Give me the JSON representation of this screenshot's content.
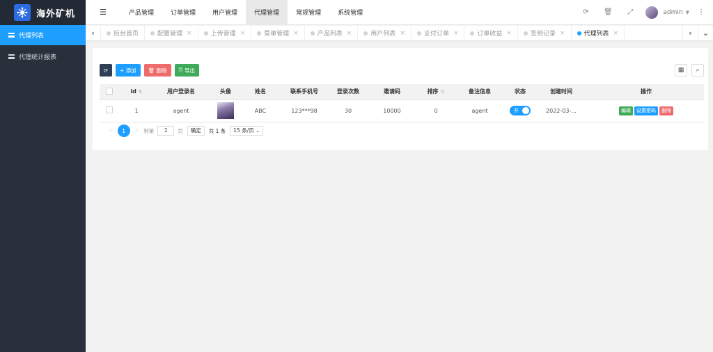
{
  "app": {
    "title": "海外矿机"
  },
  "sidebar": {
    "items": [
      {
        "label": "代理列表",
        "active": true
      },
      {
        "label": "代理统计报表",
        "active": false
      }
    ]
  },
  "topnav": {
    "items": [
      "产品管理",
      "订单管理",
      "用户管理",
      "代理管理",
      "常规管理",
      "系统管理"
    ],
    "active": "代理管理"
  },
  "user": {
    "name": "admin"
  },
  "tabs": {
    "items": [
      "后台首页",
      "配置管理",
      "上传管理",
      "菜单管理",
      "产品列表",
      "用户列表",
      "支付订单",
      "订单收益",
      "签到记录",
      "代理列表"
    ],
    "active": "代理列表"
  },
  "toolbar": {
    "add": "添加",
    "delete": "删除",
    "export": "导出"
  },
  "table": {
    "headers": [
      "id",
      "用户登录名",
      "头像",
      "姓名",
      "联系手机号",
      "登录次数",
      "邀请码",
      "排序",
      "备注信息",
      "状态",
      "创建时间",
      "操作"
    ],
    "rows": [
      {
        "id": "1",
        "login": "agent",
        "name": "ABC",
        "phone": "123***98",
        "logins": "30",
        "invite": "10000",
        "sort": "0",
        "remark": "agent",
        "status": "开",
        "created": "2022-03-..."
      }
    ],
    "actions": {
      "edit": "编辑",
      "setpwd": "设置密码",
      "del": "删除"
    }
  },
  "pager": {
    "current": "1",
    "goto_label": "到第",
    "page_value": "1",
    "page_unit": "页",
    "confirm": "确定",
    "total": "共 1 条",
    "page_size": "15 条/页"
  },
  "colors": {
    "primary": "#1e9fff",
    "sidebar": "#28303b",
    "danger": "#f06c6c",
    "success": "#3fab5a"
  }
}
